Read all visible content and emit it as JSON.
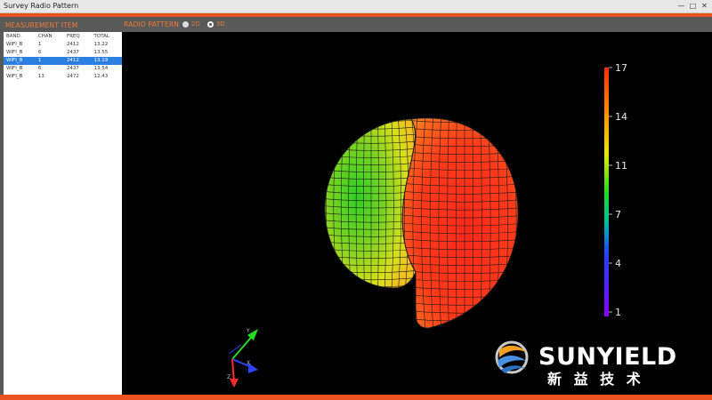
{
  "window": {
    "title": "Survey Radio Pattern",
    "controls": [
      "—",
      "□",
      "✕"
    ]
  },
  "measurement": {
    "heading": "MEASUREMENT ITEM",
    "columns": [
      "BAND",
      "CHAN",
      "FREQ",
      "TOTAL"
    ],
    "rows": [
      [
        "WIFI_B",
        "1",
        "2412",
        "13.22"
      ],
      [
        "WIFI_B",
        "6",
        "2437",
        "13.55"
      ],
      [
        "WIFI_B",
        "1",
        "2412",
        "13.19"
      ],
      [
        "WIFI_B",
        "6",
        "2437",
        "13.54"
      ],
      [
        "WIFI_B",
        "13",
        "2472",
        "12.43"
      ]
    ],
    "selected_row": 2
  },
  "pattern": {
    "heading": "RADIO PATTERN",
    "modes": [
      {
        "label": "2D",
        "checked": false
      },
      {
        "label": "3D",
        "checked": true
      }
    ]
  },
  "colorbar": {
    "ticks": [
      "17",
      "14",
      "11",
      "7",
      "4",
      "1"
    ]
  },
  "axes": {
    "labels": [
      "Y",
      "X",
      "Z"
    ]
  },
  "logo": {
    "name": "SUNYIELD",
    "chinese": "新 益 技 术"
  },
  "colors": {
    "accent": "#e8531f",
    "header_text": "#f07a37",
    "selected_row": "#2a7fe0"
  }
}
